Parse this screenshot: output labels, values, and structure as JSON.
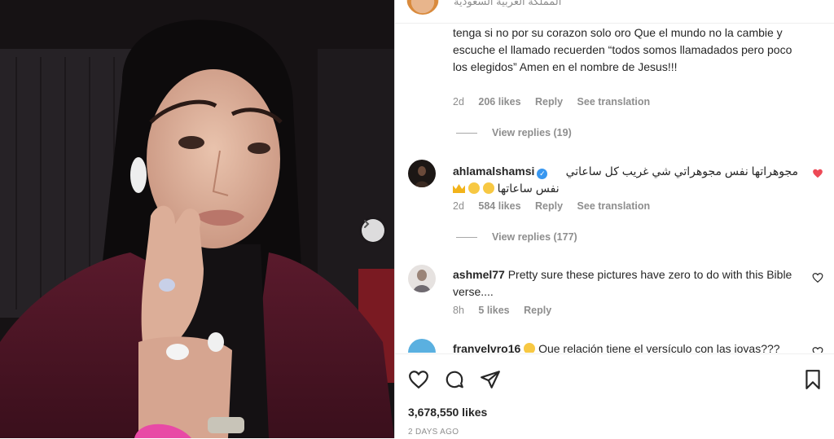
{
  "header": {
    "location": "المملكة العربية السعودية"
  },
  "comments": [
    {
      "username": "",
      "text": "tenga si no por su corazon solo oro Que el mundo no la cambie y escuche el llamado recuerden “todos somos llamadados pero poco los elegidos” Amen en el nombre de Jesus!!!",
      "time": "2d",
      "likes": "206 likes",
      "reply": "Reply",
      "translate": "See translation",
      "view_replies": "View replies (19)"
    },
    {
      "username": "ahlamalshamsi",
      "verified": true,
      "text_line1": "مجوهراتها نفس مجوهراتي شي غريب كل ساعاتي",
      "text_line2": "نفس ساعاتها",
      "time": "2d",
      "likes": "584 likes",
      "reply": "Reply",
      "translate": "See translation",
      "view_replies": "View replies (177)",
      "liked": true
    },
    {
      "username": "ashmel77",
      "text": "Pretty sure these pictures have zero to do with this Bible verse....",
      "time": "8h",
      "likes": "5 likes",
      "reply": "Reply"
    },
    {
      "username": "franvelvro16",
      "text": "Que relación tiene el versículo con las joyas???"
    }
  ],
  "post": {
    "likes": "3,678,550 likes",
    "date": "2 DAYS AGO"
  },
  "icons": {
    "like": "heart-icon",
    "comment": "comment-icon",
    "share": "send-icon",
    "save": "bookmark-icon",
    "next": "chevron-right-icon"
  },
  "colors": {
    "liked_heart": "#ed4956",
    "verified": "#3897f0",
    "meta_text": "#8e8e8e"
  }
}
